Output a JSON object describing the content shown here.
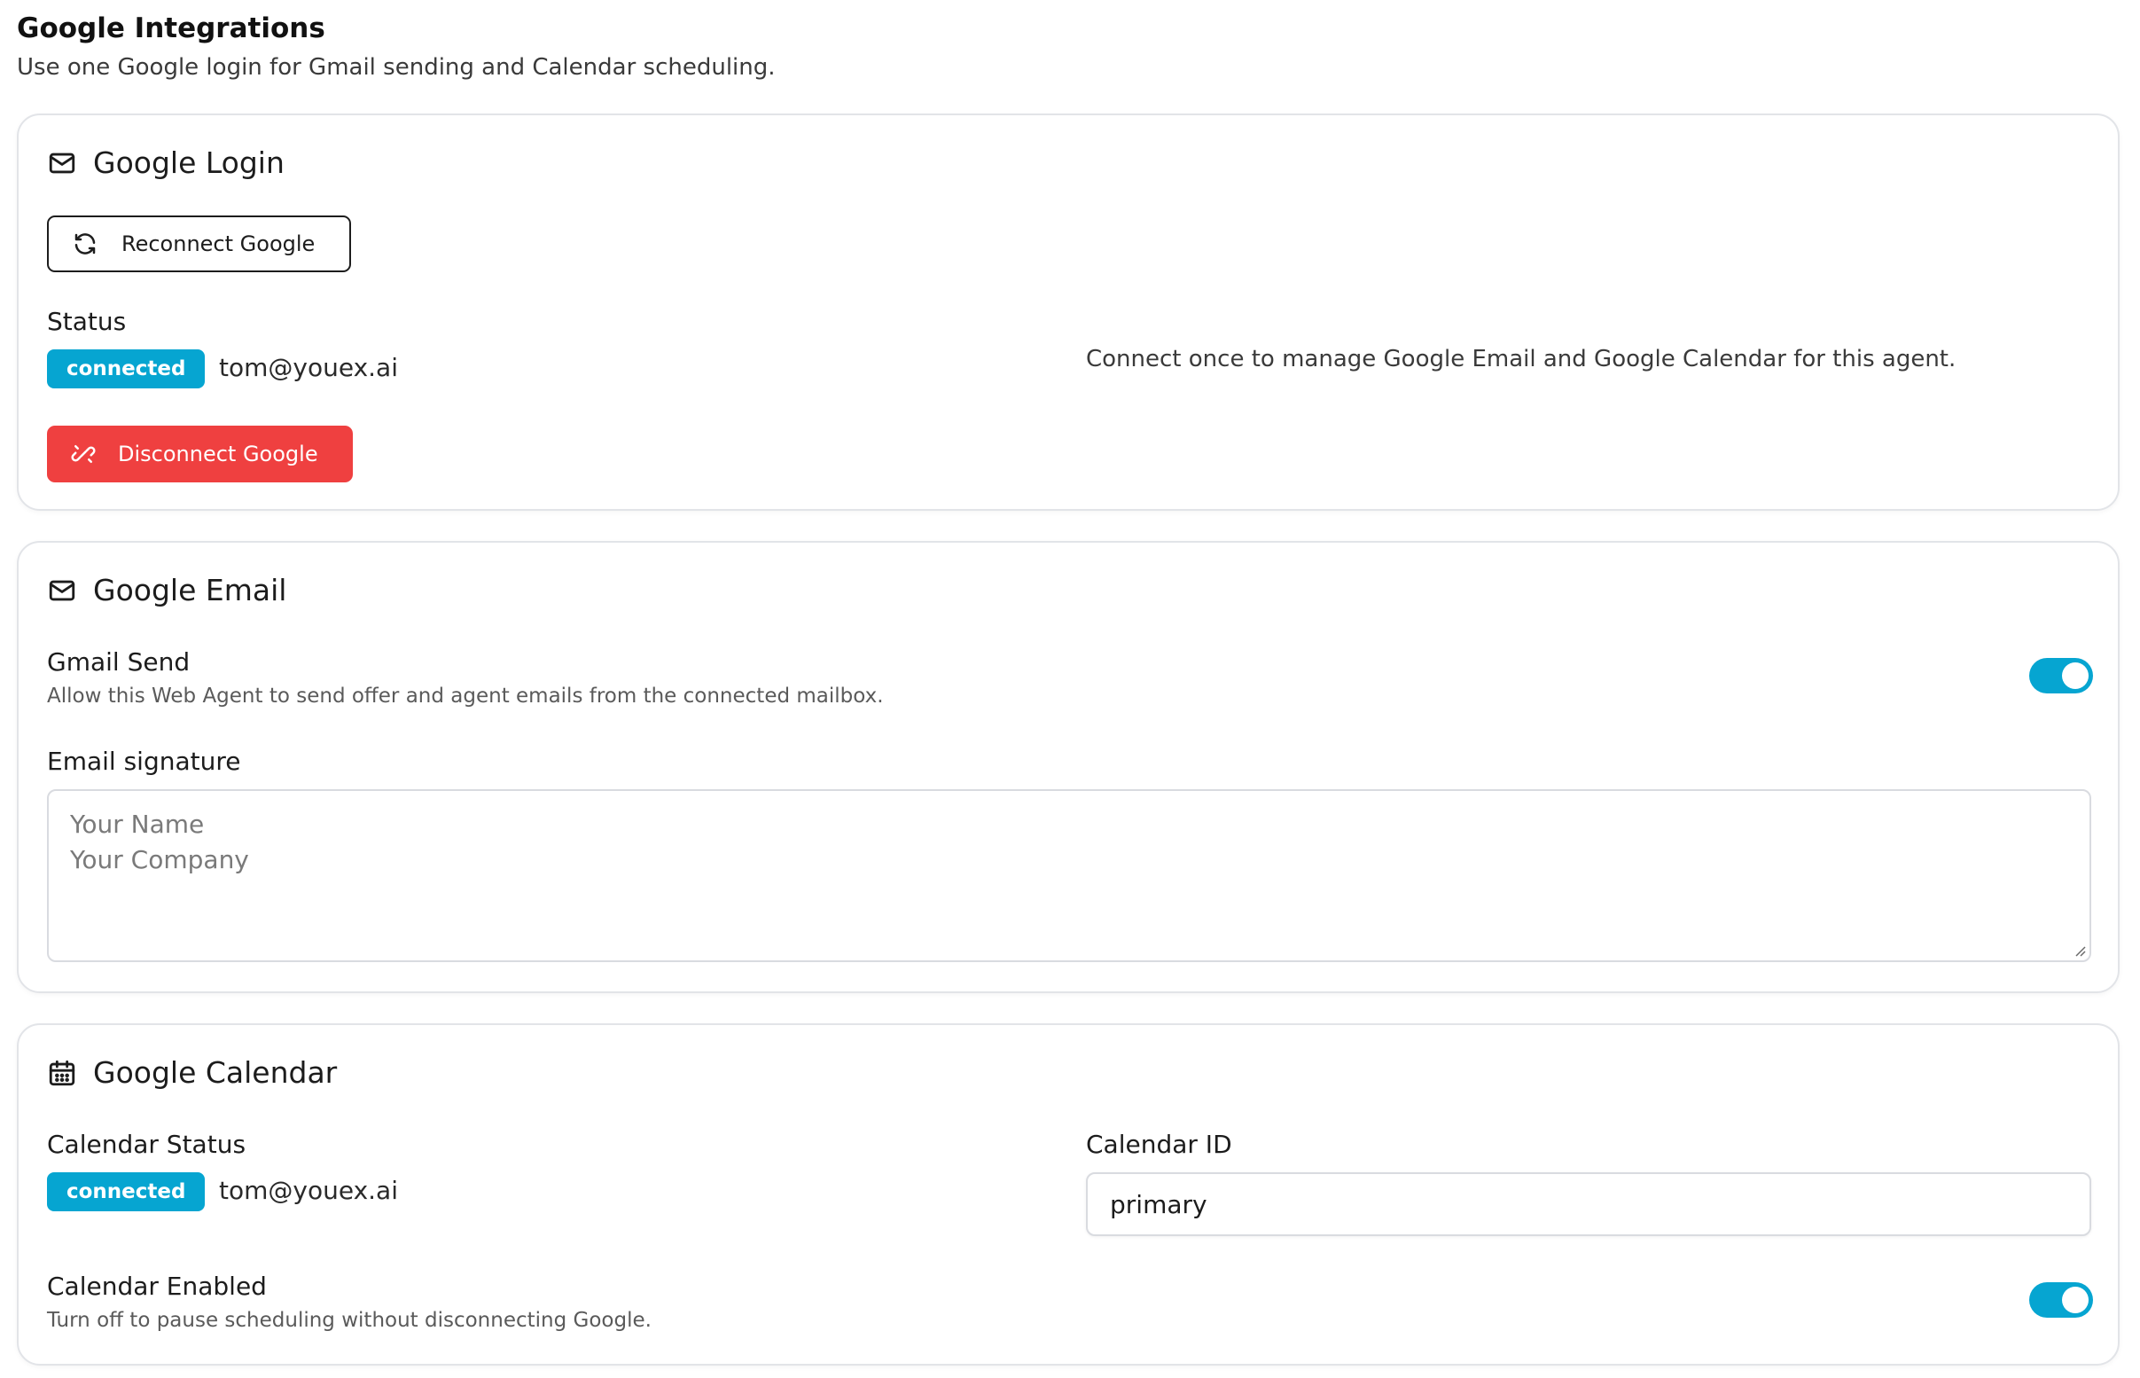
{
  "header": {
    "title": "Google Integrations",
    "subtitle": "Use one Google login for Gmail sending and Calendar scheduling."
  },
  "login_card": {
    "title": "Google Login",
    "icon": "mail-icon",
    "reconnect_label": "Reconnect Google",
    "status_label": "Status",
    "status_badge": "connected",
    "account_email": "tom@youex.ai",
    "disconnect_label": "Disconnect Google",
    "description": "Connect once to manage Google Email and Google Calendar for this agent."
  },
  "email_card": {
    "title": "Google Email",
    "icon": "mail-icon",
    "gmail_send_label": "Gmail Send",
    "gmail_send_help": "Allow this Web Agent to send offer and agent emails from the connected mailbox.",
    "gmail_send_enabled": true,
    "signature_label": "Email signature",
    "signature_placeholder_line1": "Your Name",
    "signature_placeholder_line2": "Your Company"
  },
  "calendar_card": {
    "title": "Google Calendar",
    "icon": "calendar-icon",
    "status_label": "Calendar Status",
    "status_badge": "connected",
    "account_email": "tom@youex.ai",
    "calendar_id_label": "Calendar ID",
    "calendar_id_value": "primary",
    "enabled_label": "Calendar Enabled",
    "enabled_help": "Turn off to pause scheduling without disconnecting Google.",
    "calendar_enabled": true
  },
  "colors": {
    "accent": "#06a5d1",
    "danger": "#ef4040",
    "border": "#e2e4e8"
  }
}
